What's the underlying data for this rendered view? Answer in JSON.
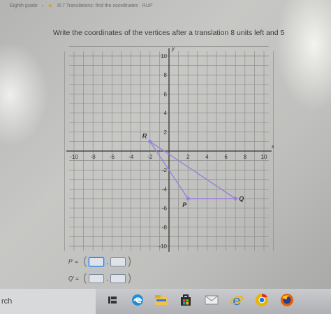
{
  "breadcrumb": {
    "grade": "Eighth grade",
    "skill": "R.7 Translations: find the coordinates",
    "code": "RUP"
  },
  "question": {
    "prompt": "Write the coordinates of the vertices after a translation 8 units left and 5"
  },
  "graph": {
    "x_tick_labels": [
      "-10",
      "-8",
      "-6",
      "-4",
      "-2",
      "2",
      "4",
      "6",
      "8",
      "10"
    ],
    "y_tick_labels": [
      "10",
      "8",
      "6",
      "4",
      "2",
      "-2",
      "-4",
      "-6",
      "-8",
      "-10"
    ],
    "x_axis_label": "x",
    "y_axis_label": "y",
    "points": [
      {
        "name": "R",
        "x": -2,
        "y": 1
      },
      {
        "name": "P",
        "x": 2,
        "y": -5
      },
      {
        "name": "Q",
        "x": 7,
        "y": -5
      }
    ],
    "colors": {
      "shape": "#9b7fd8",
      "grid": "#8e8f8c",
      "axis": "#333333"
    }
  },
  "answers": {
    "p_label": "P' =",
    "q_label": "Q' ="
  },
  "taskbar": {
    "search_text": "rch",
    "icons": [
      "task-view-icon",
      "edge-icon",
      "file-explorer-icon",
      "store-icon",
      "mail-icon",
      "ie-icon",
      "chrome-icon",
      "firefox-icon"
    ]
  }
}
